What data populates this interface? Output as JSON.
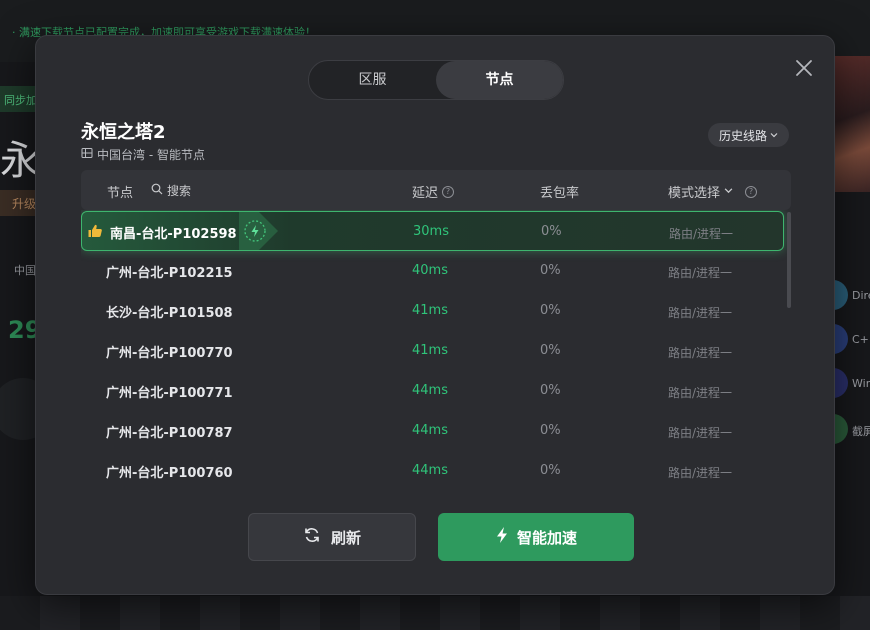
{
  "background": {
    "banner_text": "· 满速下载节点已配置完成，加速即可享受游戏下载满速体验！",
    "badge": "同步加",
    "title_char": "永",
    "upgrade_label": "升级",
    "region_text": "中国",
    "number": "29",
    "right_items": [
      {
        "label": "Dire",
        "color": "#2a5f7a"
      },
      {
        "label": "C++",
        "color": "#2a3f7a"
      },
      {
        "label": "Win",
        "color": "#2a2f6a"
      },
      {
        "label": "截屏",
        "color": "#2a5a3a"
      }
    ]
  },
  "modal": {
    "tabs": [
      {
        "label": "区服",
        "active": false
      },
      {
        "label": "节点",
        "active": true
      }
    ],
    "game_title": "永恒之塔2",
    "game_subtitle": "中国台湾 - 智能节点",
    "history_button": "历史线路",
    "table": {
      "headers": {
        "node": "节点",
        "search_placeholder": "搜索",
        "latency": "延迟",
        "loss": "丢包率",
        "mode": "模式选择"
      },
      "rows": [
        {
          "name": "南昌-台北-P102598",
          "latency": "30ms",
          "loss": "0%",
          "mode": "路由/进程一",
          "selected": true
        },
        {
          "name": "广州-台北-P102215",
          "latency": "40ms",
          "loss": "0%",
          "mode": "路由/进程一",
          "selected": false
        },
        {
          "name": "长沙-台北-P101508",
          "latency": "41ms",
          "loss": "0%",
          "mode": "路由/进程一",
          "selected": false
        },
        {
          "name": "广州-台北-P100770",
          "latency": "41ms",
          "loss": "0%",
          "mode": "路由/进程一",
          "selected": false
        },
        {
          "name": "广州-台北-P100771",
          "latency": "44ms",
          "loss": "0%",
          "mode": "路由/进程一",
          "selected": false
        },
        {
          "name": "广州-台北-P100787",
          "latency": "44ms",
          "loss": "0%",
          "mode": "路由/进程一",
          "selected": false
        },
        {
          "name": "广州-台北-P100760",
          "latency": "44ms",
          "loss": "0%",
          "mode": "路由/进程一",
          "selected": false
        }
      ]
    },
    "refresh_button": "刷新",
    "boost_button": "智能加速"
  },
  "colors": {
    "accent_green": "#2e9a5e",
    "latency_green": "#2fc47a",
    "modal_bg": "#2b2c30"
  }
}
